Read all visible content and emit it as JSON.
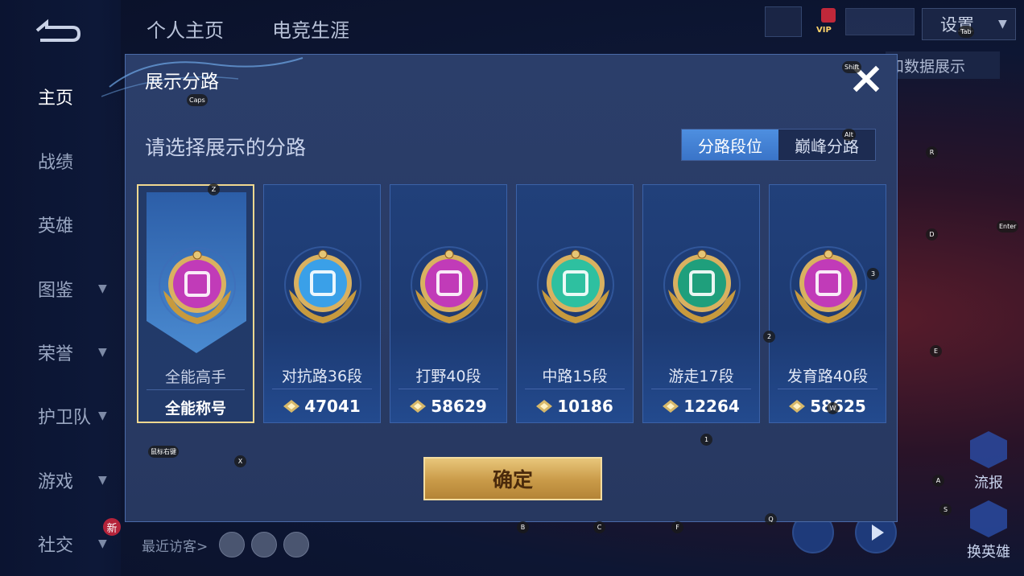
{
  "sidebar": {
    "items": [
      {
        "label": "主页",
        "active": true,
        "chevron": false
      },
      {
        "label": "战绩",
        "active": false,
        "chevron": false
      },
      {
        "label": "英雄",
        "active": false,
        "chevron": false
      },
      {
        "label": "图鉴",
        "active": false,
        "chevron": true
      },
      {
        "label": "荣誉",
        "active": false,
        "chevron": true
      },
      {
        "label": "护卫队",
        "active": false,
        "chevron": true
      },
      {
        "label": "游戏",
        "active": false,
        "chevron": true
      },
      {
        "label": "社交",
        "active": false,
        "chevron": true
      }
    ],
    "new_badge": "新"
  },
  "top_tabs": [
    "个人主页",
    "电竞生涯"
  ],
  "settings_label": "设置",
  "vip_label": "VIP",
  "bg_partial_label": "和数据展示",
  "recent_visitors_label": "最近访客>",
  "right_buttons": {
    "skin": "流报",
    "switch_hero": "换英雄"
  },
  "modal": {
    "title": "展示分路",
    "subtitle": "请选择展示的分路",
    "segment": {
      "options": [
        "分路段位",
        "巅峰分路"
      ],
      "selected": 0
    },
    "confirm_label": "确定",
    "cards": [
      {
        "name": "全能高手",
        "value": "全能称号",
        "color": "#c13bb8",
        "show_icon": false,
        "selected": true
      },
      {
        "name": "对抗路36段",
        "value": "47041",
        "color": "#3aa0e8",
        "show_icon": true,
        "selected": false
      },
      {
        "name": "打野40段",
        "value": "58629",
        "color": "#c13bb8",
        "show_icon": true,
        "selected": false
      },
      {
        "name": "中路15段",
        "value": "10186",
        "color": "#2ec0a0",
        "show_icon": true,
        "selected": false
      },
      {
        "name": "游走17段",
        "value": "12264",
        "color": "#1f9f7c",
        "show_icon": true,
        "selected": false
      },
      {
        "name": "发育路40段",
        "value": "58625",
        "color": "#c13bb8",
        "show_icon": true,
        "selected": false
      }
    ]
  },
  "key_hints": [
    "Tab",
    "Shift",
    "Caps",
    "Alt",
    "R",
    "Z",
    "D",
    "Enter",
    "3",
    "2",
    "E",
    "1",
    "鼠标右键",
    "X",
    "W",
    "A",
    "S",
    "B",
    "C",
    "F",
    "Q"
  ],
  "colors": {
    "gold": "#e8c67a",
    "accent_blue": "#4e8fe0",
    "modal_bg": "#2b3e6a"
  }
}
